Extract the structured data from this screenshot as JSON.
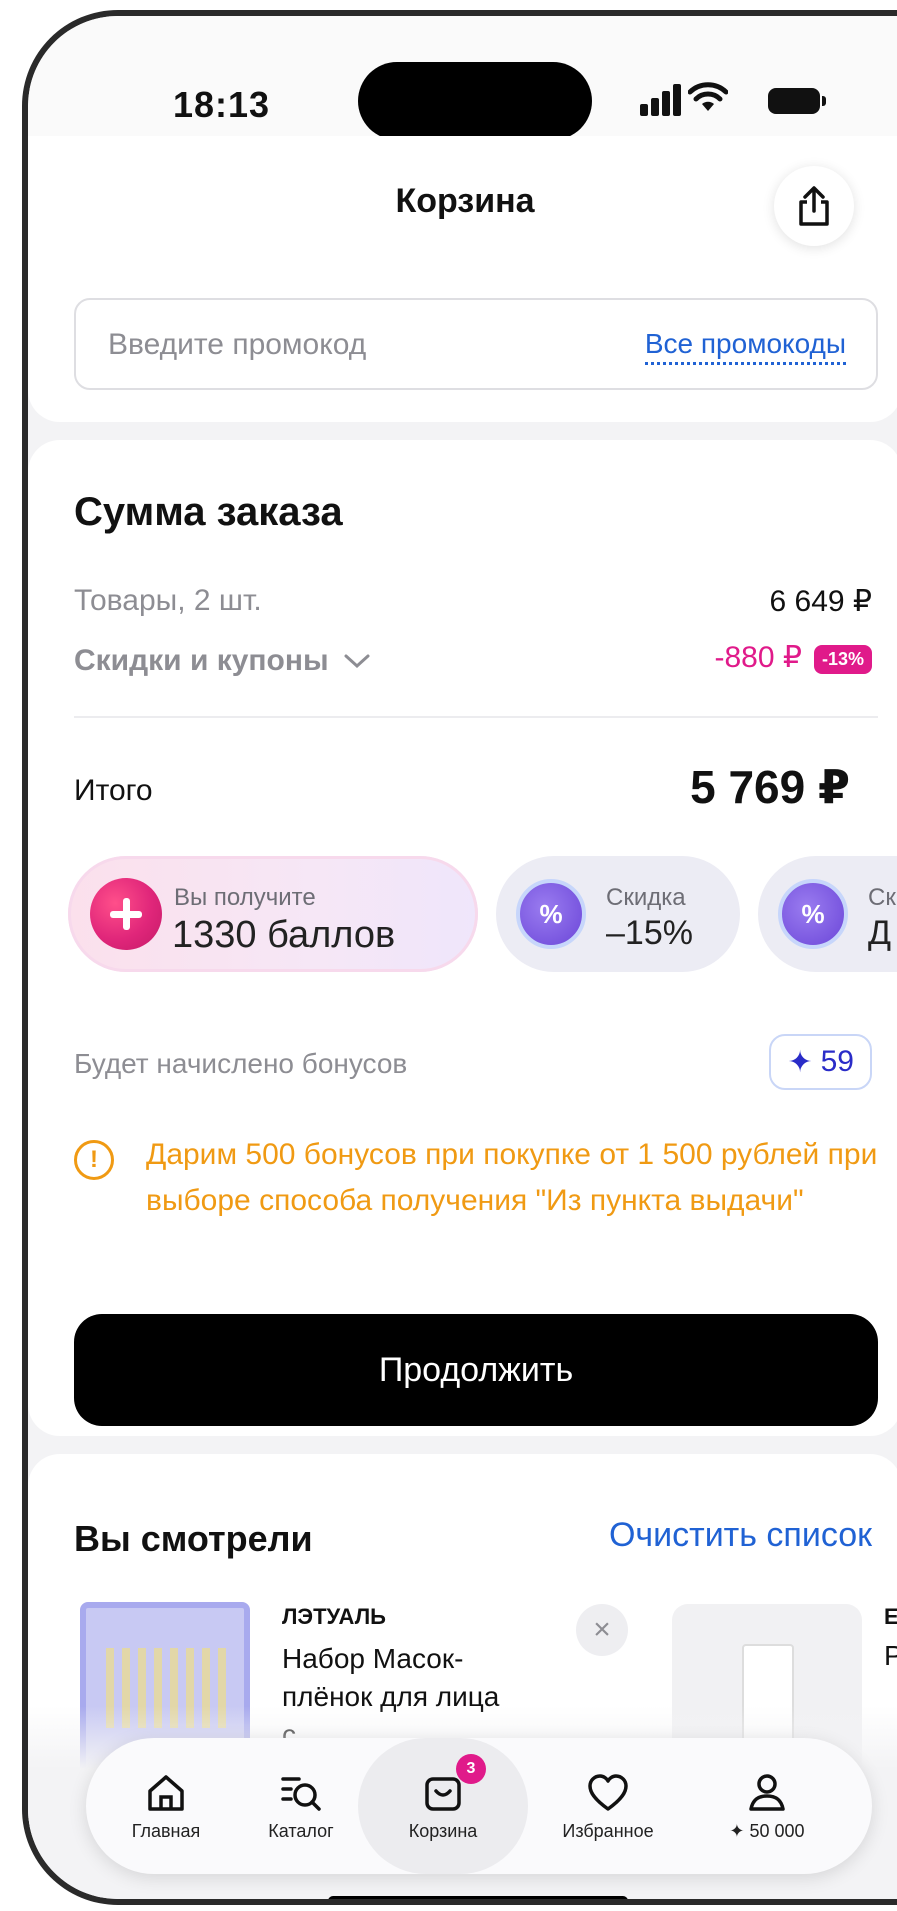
{
  "status_bar": {
    "time": "18:13"
  },
  "header": {
    "title": "Корзина"
  },
  "promo": {
    "placeholder": "Введите промокод",
    "all_link": "Все промокоды"
  },
  "summary": {
    "title": "Сумма заказа",
    "goods_label": "Товары, 2 шт.",
    "goods_value": "6 649 ₽",
    "discounts_label": "Скидки и купоны",
    "discounts_value": "-880 ₽",
    "discounts_badge": "-13%",
    "total_label": "Итого",
    "total_value": "5 769 ₽"
  },
  "chips": [
    {
      "small": "Вы получите",
      "big": "1330 баллов"
    },
    {
      "small": "Скидка",
      "big": "–15%",
      "icon_text": "%"
    },
    {
      "small": "Ск",
      "big": "Д",
      "icon_text": "%"
    }
  ],
  "bonus": {
    "label": "Будет начислено бонусов",
    "value": "59",
    "star": "✦"
  },
  "notice": {
    "icon": "!",
    "text": "Дарим 500 бонусов при покупке от 1 500 рублей при выборе способа получения \"Из пункта выдачи\""
  },
  "cta": {
    "label": "Продолжить"
  },
  "viewed": {
    "title": "Вы смотрели",
    "clear": "Очистить список",
    "items": [
      {
        "brand": "ЛЭТУАЛЬ",
        "name": "Набор Масок-плёнок для лица с"
      },
      {
        "brand": "EF",
        "name": "Ра"
      }
    ],
    "close_symbol": "×"
  },
  "tabbar": {
    "tabs": [
      {
        "label": "Главная"
      },
      {
        "label": "Каталог"
      },
      {
        "label": "Корзина",
        "badge": "3"
      },
      {
        "label": "Избранное"
      },
      {
        "label": "✦ 50 000"
      }
    ]
  },
  "colors": {
    "accent_pink": "#e01a8a",
    "link_blue": "#2062d4",
    "warning_orange": "#f09a13"
  }
}
